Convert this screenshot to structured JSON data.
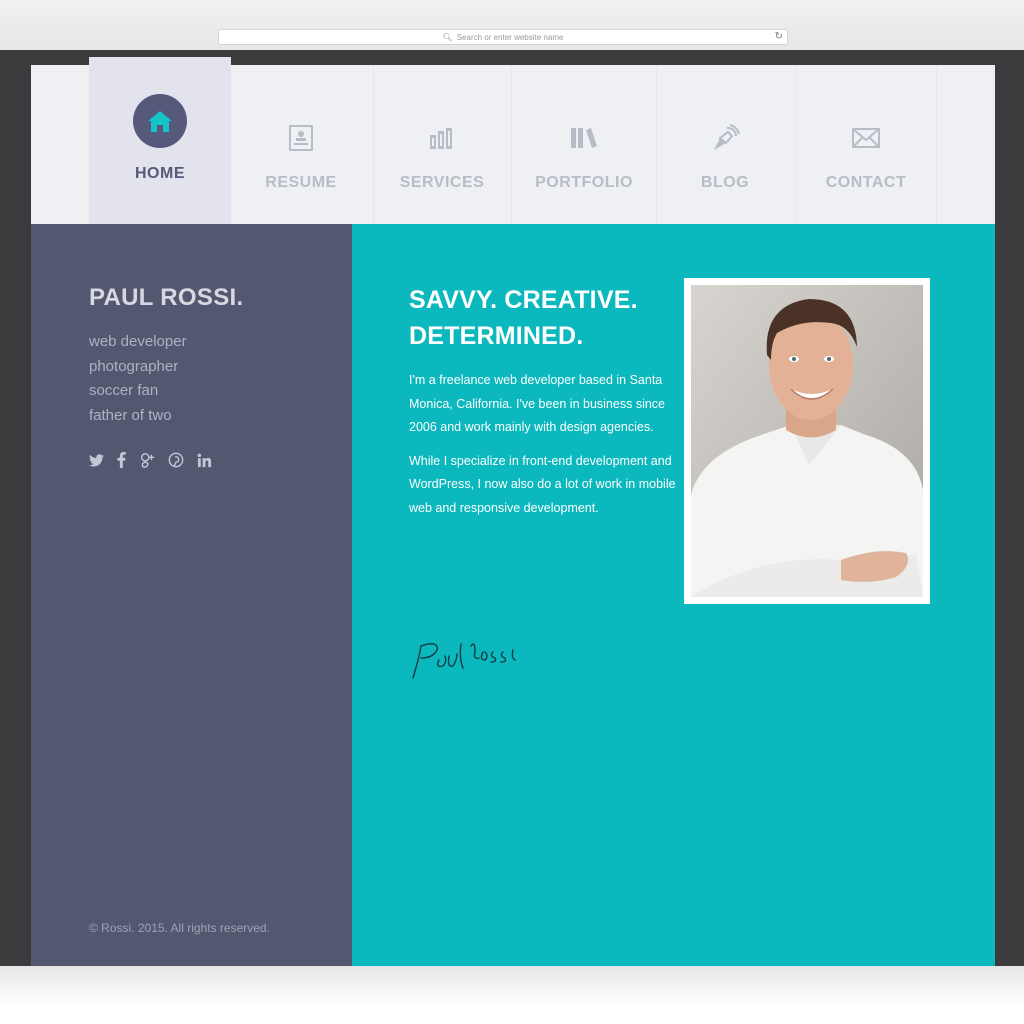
{
  "browser": {
    "address_placeholder": "Search or enter website name"
  },
  "nav": {
    "items": [
      {
        "label": "HOME",
        "icon": "home-icon",
        "active": true
      },
      {
        "label": "RESUME",
        "icon": "resume-icon",
        "active": false
      },
      {
        "label": "SERVICES",
        "icon": "services-icon",
        "active": false
      },
      {
        "label": "PORTFOLIO",
        "icon": "portfolio-icon",
        "active": false
      },
      {
        "label": "BLOG",
        "icon": "blog-icon",
        "active": false
      },
      {
        "label": "CONTACT",
        "icon": "contact-icon",
        "active": false
      }
    ]
  },
  "sidebar": {
    "name": "PAUL ROSSI.",
    "roles": [
      "web developer",
      "photographer",
      "soccer fan",
      "father of two"
    ],
    "social": [
      "twitter-icon",
      "facebook-icon",
      "google-plus-icon",
      "pinterest-icon",
      "linkedin-icon"
    ],
    "copyright": "© Rossi. 2015. All rights reserved."
  },
  "main": {
    "headline_line1": "SAVVY. CREATIVE.",
    "headline_line2": "DETERMINED.",
    "bio_p1": "I'm a freelance web developer based in Santa Monica, California. I've been in business since 2006 and work mainly with design agencies.",
    "bio_p2": "While I specialize in front-end development and WordPress, I now also do a lot of work in mobile web and responsive development.",
    "signature": "Paul Rossi"
  },
  "colors": {
    "teal": "#0ab8bd",
    "sidebar": "#535870",
    "nav_bg": "#eef0f4",
    "accent_active": "#56597a",
    "frame": "#3b3b3d"
  }
}
